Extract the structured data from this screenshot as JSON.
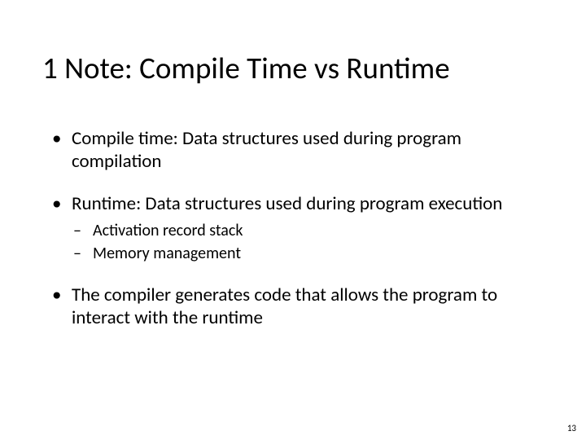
{
  "title": "1 Note: Compile Time vs Runtime",
  "bullets": [
    {
      "text": "Compile time: Data structures used during program compilation",
      "children": []
    },
    {
      "text": "Runtime: Data structures used during program execution",
      "children": [
        "Activation record stack",
        "Memory management"
      ]
    },
    {
      "text": "The compiler generates code that allows the program to interact with the runtime",
      "children": []
    }
  ],
  "page_number": "13"
}
